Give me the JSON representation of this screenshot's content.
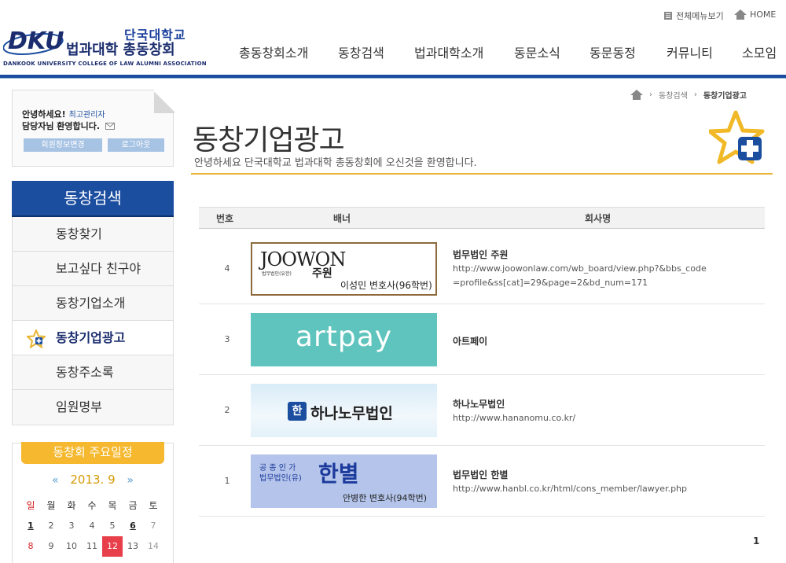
{
  "header": {
    "logo_mark": "DKU",
    "logo_kor1": "단국대학교",
    "logo_kor2": "법과대학 총동창회",
    "logo_eng": "DANKOOK UNIVERSITY COLLEGE OF LAW ALUMNI ASSOCIATION",
    "util_menu": "전체메뉴보기",
    "util_home": "HOME",
    "gnb": [
      "총동창회소개",
      "동창검색",
      "법과대학소개",
      "동문소식",
      "동문동정",
      "커뮤니티",
      "소모임"
    ]
  },
  "login": {
    "greeting": "안녕하세요!",
    "role": "최고관리자",
    "line2": "담당자님 환영합니다.",
    "btn_info": "회원정보변경",
    "btn_logout": "로그아웃"
  },
  "lnb": {
    "title": "동창검색",
    "items": [
      {
        "label": "동창찾기"
      },
      {
        "label": "보고싶다 친구야"
      },
      {
        "label": "동창기업소개"
      },
      {
        "label": "동창기업광고"
      },
      {
        "label": "동창주소록"
      },
      {
        "label": "임원명부"
      }
    ],
    "active_index": 3
  },
  "schedule": {
    "title": "동창회 주요일정",
    "month": "2013. 9",
    "prev": "«",
    "next": "»",
    "weekdays": [
      "일",
      "월",
      "화",
      "수",
      "목",
      "금",
      "토"
    ],
    "weeks": [
      [
        "1",
        "2",
        "3",
        "4",
        "5",
        "6",
        "7"
      ],
      [
        "8",
        "9",
        "10",
        "11",
        "12",
        "13",
        "14"
      ]
    ],
    "today": "12",
    "event_days": [
      "1",
      "6"
    ],
    "sunday_color": "#d42222",
    "today_bg": "#e8404a"
  },
  "breadcrumb": {
    "home": "home-icon",
    "items": [
      "동창검색",
      "동창기업광고"
    ]
  },
  "page": {
    "title": "동창기업광고",
    "subtitle": "안녕하세요 단국대학교 법과대학 총동창회에 오신것을 환영합니다."
  },
  "table": {
    "headers": [
      "번호",
      "배너",
      "회사명"
    ],
    "rows": [
      {
        "num": "4",
        "banner_title": "JOOWON",
        "banner_sub1": "법무법인(유한)",
        "banner_sub2": "주원",
        "banner_name": "이성민 변호사(96학번)",
        "company": "법무법인 주원",
        "url": "http://www.joowonlaw.com/wb_board/view.php?&bbs_code=profile&ss[cat]=29&page=2&bd_num=171"
      },
      {
        "num": "3",
        "banner_title": "artpay",
        "company": "아트페이",
        "url": ""
      },
      {
        "num": "2",
        "banner_logo": "한",
        "banner_title": "하나노무법인",
        "company": "하나노무법인",
        "url": "http://www.hananomu.co.kr/"
      },
      {
        "num": "1",
        "banner_top": "공 종 인 가",
        "banner_sub": "법무법인(유)",
        "banner_title": "한별",
        "banner_name": "안병한 변호사(94학번)",
        "company": "법무법인 한별",
        "url": "http://www.hanbl.co.kr/html/cons_member/lawyer.php"
      }
    ]
  },
  "pager": {
    "current": "1"
  },
  "colors": {
    "brand": "#1c4ea0",
    "accent": "#e8b532",
    "artpay": "#5fc4bd"
  }
}
